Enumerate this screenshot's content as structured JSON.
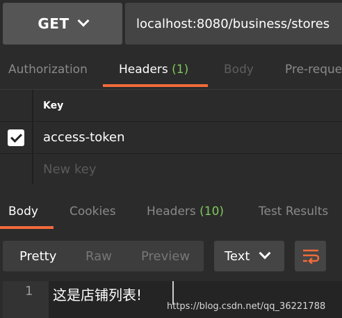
{
  "request": {
    "method": "GET",
    "url": "localhost:8080/business/stores"
  },
  "request_tabs": [
    {
      "label": "Authorization",
      "count": ""
    },
    {
      "label": "Headers",
      "count": "(1)"
    },
    {
      "label": "Body",
      "count": ""
    },
    {
      "label": "Pre-reque",
      "count": ""
    }
  ],
  "headers_table": {
    "column_key": "Key",
    "rows": [
      {
        "checked": true,
        "key": "access-token"
      }
    ],
    "new_key_placeholder": "New key"
  },
  "response_tabs": [
    {
      "label": "Body",
      "count": ""
    },
    {
      "label": "Cookies",
      "count": ""
    },
    {
      "label": "Headers",
      "count": "(10)"
    },
    {
      "label": "Test Results",
      "count": ""
    }
  ],
  "response_toolbar": {
    "view_options": [
      "Pretty",
      "Raw",
      "Preview"
    ],
    "format": "Text"
  },
  "response_body": {
    "lines": [
      {
        "number": "1",
        "text": "这是店铺列表!"
      }
    ]
  },
  "watermark": "https://blog.csdn.net/qq_36221788",
  "colors": {
    "accent": "#f26b3a",
    "count": "#7ec95b",
    "background": "#2b2b2b"
  },
  "icons": {
    "method_dropdown": "chevron-down-icon",
    "format_dropdown": "chevron-down-icon",
    "wrap": "wrap-lines-icon",
    "checkbox": "checkmark-icon"
  }
}
